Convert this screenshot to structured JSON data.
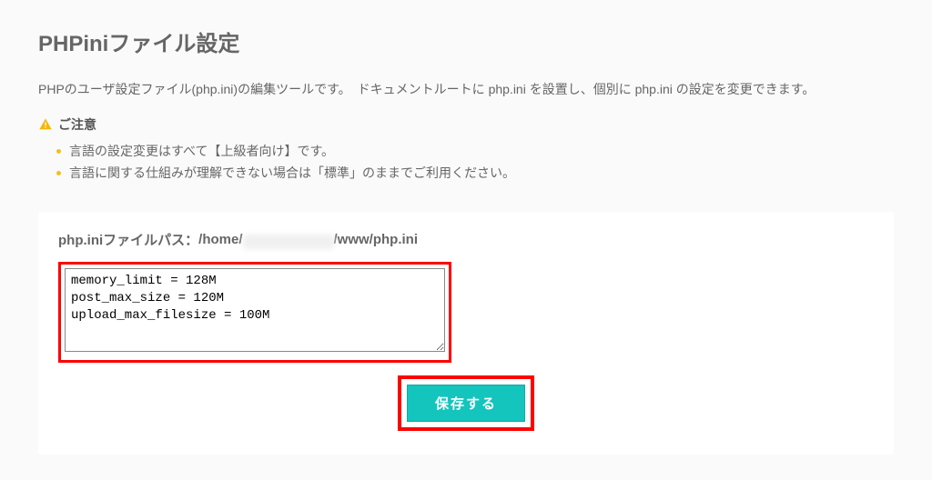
{
  "page_title": "PHPiniファイル設定",
  "description": "PHPのユーザ設定ファイル(php.ini)の編集ツールです。　ドキュメントルートに php.ini を設置し、個別に php.ini の設定を変更できます。",
  "caution": {
    "title": "ご注意",
    "items": [
      "言語の設定変更はすべて【上級者向け】です。",
      "言語に関する仕組みが理解できない場合は「標準」のままでご利用ください。"
    ]
  },
  "filepath": {
    "label": "php.iniファイルパス：",
    "prefix": "/home/",
    "suffix": "/www/php.ini"
  },
  "ini_content": "memory_limit = 128M\npost_max_size = 120M\nupload_max_filesize = 100M",
  "save_button": "保存する"
}
